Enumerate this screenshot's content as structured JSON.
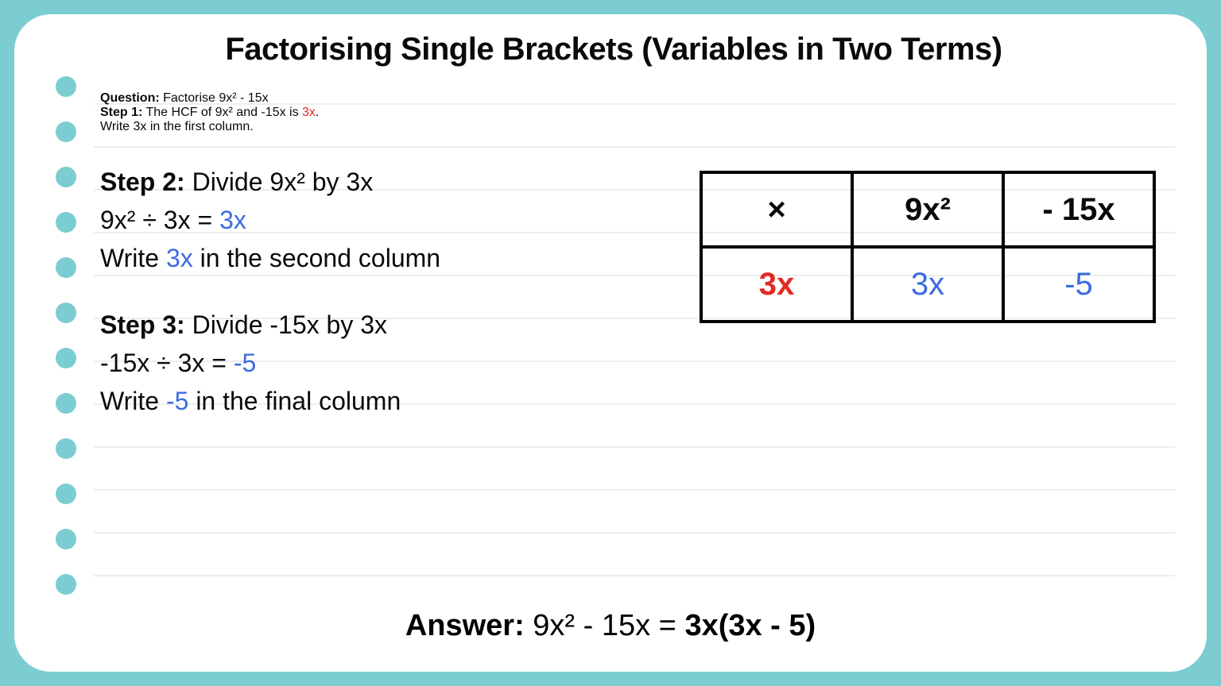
{
  "title": "Factorising Single Brackets (Variables in Two Terms)",
  "question": {
    "label": "Question:",
    "text": " Factorise 9x² - 15x"
  },
  "step1": {
    "label": "Step 1:",
    "text_a": " The HCF of 9x² and -15x is ",
    "hcf": "3x",
    "text_b": ".",
    "line2": "Write 3x in the first column."
  },
  "step2": {
    "label": "Step 2:",
    "text": " Divide 9x² by 3x",
    "eq_a": "9x² ÷ 3x = ",
    "eq_b": "3x",
    "w_a": "Write ",
    "w_b": "3x",
    "w_c": " in the second column"
  },
  "step3": {
    "label": "Step 3:",
    "text": " Divide -15x by 3x",
    "eq_a": "-15x ÷ 3x = ",
    "eq_b": "-5",
    "w_a": "Write ",
    "w_b": "-5",
    "w_c": " in the final column"
  },
  "table": {
    "h1": "×",
    "h2": "9x²",
    "h3": "- 15x",
    "r1": "3x",
    "r2": "3x",
    "r3": "-5"
  },
  "answer": {
    "label": "Answer:",
    "lhs": " 9x² - 15x =  ",
    "rhs": "3x(3x - 5)"
  }
}
